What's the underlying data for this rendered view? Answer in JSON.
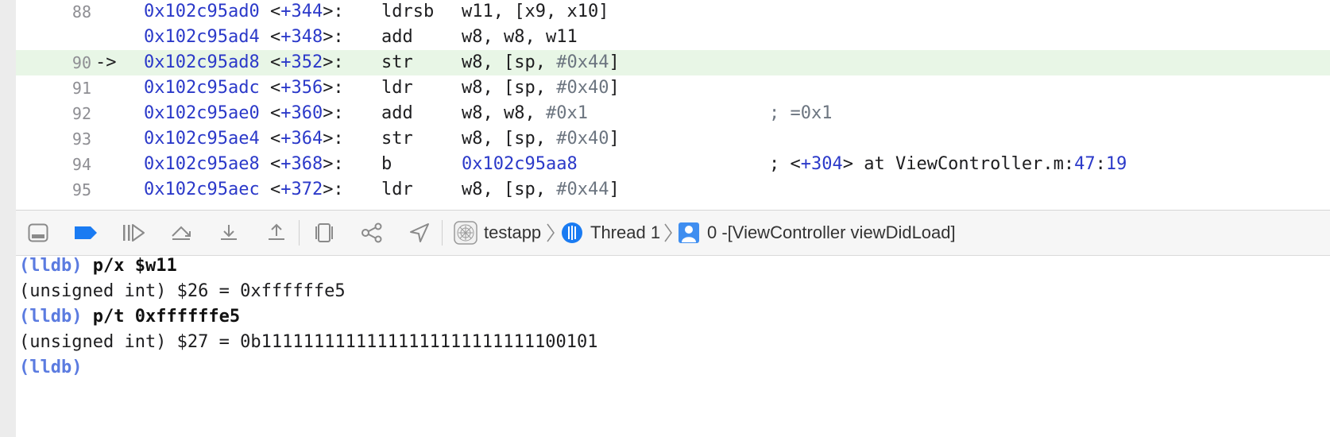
{
  "disassembly": {
    "rows": [
      {
        "line": "88",
        "arrow": "",
        "address": "0x102c95ad0",
        "offset": "+344",
        "op": "ldrsb",
        "args": [
          {
            "t": "w11, [x9, x10]",
            "c": ""
          }
        ],
        "comment": []
      },
      {
        "line": "",
        "arrow": "",
        "address": "0x102c95ad4",
        "offset": "+348",
        "op": "add",
        "args": [
          {
            "t": "w8, w8, w11",
            "c": ""
          }
        ],
        "comment": []
      },
      {
        "line": "90",
        "arrow": "->",
        "address": "0x102c95ad8",
        "offset": "+352",
        "op": "str",
        "args": [
          {
            "t": "w8, [sp, ",
            "c": ""
          },
          {
            "t": "#0x44",
            "c": "gray"
          },
          {
            "t": "]",
            "c": ""
          }
        ],
        "comment": []
      },
      {
        "line": "91",
        "arrow": "",
        "address": "0x102c95adc",
        "offset": "+356",
        "op": "ldr",
        "args": [
          {
            "t": "w8, [sp, ",
            "c": ""
          },
          {
            "t": "#0x40",
            "c": "gray"
          },
          {
            "t": "]",
            "c": ""
          }
        ],
        "comment": []
      },
      {
        "line": "92",
        "arrow": "",
        "address": "0x102c95ae0",
        "offset": "+360",
        "op": "add",
        "args": [
          {
            "t": "w8, w8, ",
            "c": ""
          },
          {
            "t": "#0x1",
            "c": "gray"
          }
        ],
        "comment": [
          {
            "t": "; =0x1",
            "c": "gray"
          }
        ]
      },
      {
        "line": "93",
        "arrow": "",
        "address": "0x102c95ae4",
        "offset": "+364",
        "op": "str",
        "args": [
          {
            "t": "w8, [sp, ",
            "c": ""
          },
          {
            "t": "#0x40",
            "c": "gray"
          },
          {
            "t": "]",
            "c": ""
          }
        ],
        "comment": []
      },
      {
        "line": "94",
        "arrow": "",
        "address": "0x102c95ae8",
        "offset": "+368",
        "op": "b",
        "args": [
          {
            "t": "0x102c95aa8",
            "c": "blue"
          }
        ],
        "comment": [
          {
            "t": "; <",
            "c": ""
          },
          {
            "t": "+304",
            "c": "blue"
          },
          {
            "t": "> at ViewController.m:",
            "c": ""
          },
          {
            "t": "47",
            "c": "blue"
          },
          {
            "t": ":",
            "c": ""
          },
          {
            "t": "19",
            "c": "blue"
          }
        ]
      },
      {
        "line": "95",
        "arrow": "",
        "address": "0x102c95aec",
        "offset": "+372",
        "op": "ldr",
        "args": [
          {
            "t": "w8, [sp, ",
            "c": ""
          },
          {
            "t": "#0x44",
            "c": "gray"
          },
          {
            "t": "]",
            "c": ""
          }
        ],
        "comment": []
      }
    ],
    "current_index": 2
  },
  "debug_bar": {
    "breadcrumb": {
      "app": "testapp",
      "thread": "Thread 1",
      "frame": "0 -[ViewController viewDidLoad]"
    },
    "colors": {
      "active": "#1a7bf2",
      "icon": "#8a8a8a"
    }
  },
  "console": {
    "lines": [
      {
        "prompt": "(lldb)",
        "text": "p/x $w11"
      },
      {
        "prompt": "",
        "text": "(unsigned int) $26 = 0xffffffe5"
      },
      {
        "prompt": "(lldb)",
        "text": "p/t 0xffffffe5"
      },
      {
        "prompt": "",
        "text": "(unsigned int) $27 = 0b11111111111111111111111111100101"
      },
      {
        "prompt": "(lldb)",
        "text": ""
      }
    ]
  }
}
